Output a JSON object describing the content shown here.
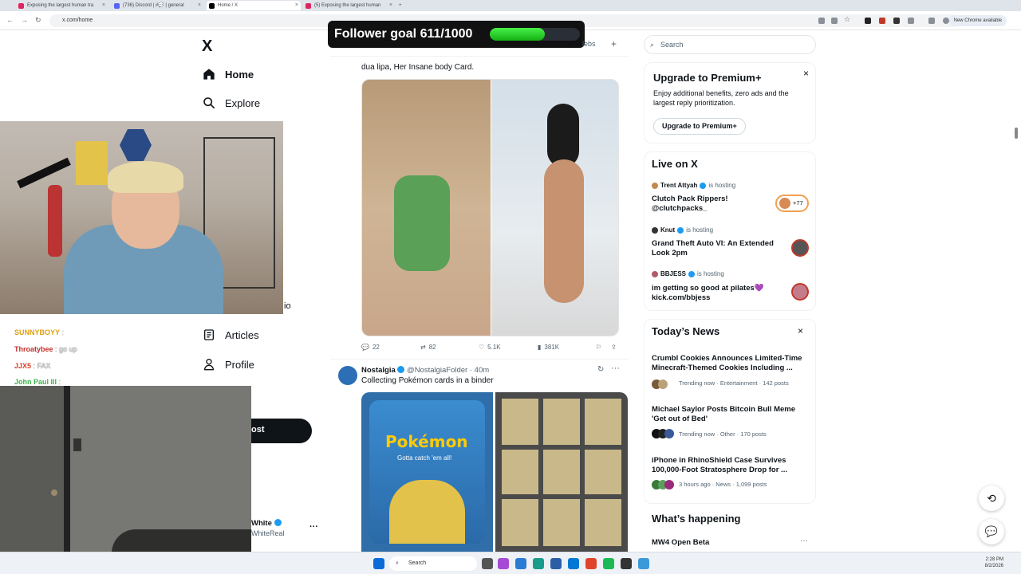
{
  "browser": {
    "tabs": [
      {
        "label": "Exposing the largest human tra",
        "color": "#e0245e"
      },
      {
        "label": "(736) Discord | #💬 | general",
        "color": "#5865f2"
      },
      {
        "label": "Home / X",
        "color": "#000000"
      },
      {
        "label": "(5) Exposing the largest human",
        "color": "#e0245e"
      }
    ],
    "url": "x.com/home",
    "update_label": "New Chrome available"
  },
  "goal": {
    "text": "Follower goal 611/1000",
    "progress": 0.611
  },
  "left_nav": {
    "logo": "X",
    "items": [
      {
        "label": "Home",
        "icon": "home-icon"
      },
      {
        "label": "Explore",
        "icon": "search-icon"
      },
      {
        "label": "Articles",
        "icon": "articles-icon"
      },
      {
        "label": "Profile",
        "icon": "profile-icon"
      }
    ],
    "post_partial": "ost",
    "account_name_partial": "White",
    "account_handle_partial": "WhiteReal",
    "partial_io": "io"
  },
  "chat": [
    {
      "user": "SUNNYBOYY",
      "msg": ":",
      "color": "#e0a010"
    },
    {
      "user": "Throatybee",
      "msg": ": go up",
      "color": "#c0302b"
    },
    {
      "user": "JJX5",
      "msg": ": FAX",
      "color": "#d8402a"
    },
    {
      "user": "John Paul III",
      "msg": ":",
      "color": "#3cb44b"
    }
  ],
  "feed": {
    "tab_partial": "lebs",
    "tweet1": {
      "text": "dua lipa, Her Insane body Card.",
      "replies": "22",
      "reposts": "82",
      "likes": "5.1K",
      "views": "381K"
    },
    "tweet2": {
      "name": "Nostalgia",
      "handle": "@NostalgiaFolder",
      "time": "· 40m",
      "text": "Collecting Pokémon cards in a binder",
      "image_text": "Pokémon",
      "image_sub": "Gotta catch 'em all!"
    }
  },
  "sidebar": {
    "search_placeholder": "Search",
    "premium": {
      "title": "Upgrade to Premium+",
      "desc": "Enjoy additional benefits, zero ads and the largest reply prioritization.",
      "button": "Upgrade to Premium+"
    },
    "live": {
      "title": "Live on X",
      "items": [
        {
          "host": "Trent Attyah",
          "hosting": "is hosting",
          "title": "Clutch Pack Rippers! @clutchpacks_",
          "badge": "+77"
        },
        {
          "host": "Knut",
          "hosting": "is hosting",
          "title": "Grand Theft Auto VI: An Extended Look 2pm"
        },
        {
          "host": "BBJESS",
          "hosting": "is hosting",
          "title": "im getting so good at pilates💜 kick.com/bbjess"
        }
      ]
    },
    "news": {
      "title": "Today’s News",
      "items": [
        {
          "title": "Crumbl Cookies Announces Limited-Time Minecraft-Themed Cookies Including ...",
          "meta": "Trending now · Entertainment · 142 posts"
        },
        {
          "title": "Michael Saylor Posts Bitcoin Bull Meme 'Get out of Bed'",
          "meta": "Trending now · Other · 170 posts"
        },
        {
          "title": "iPhone in RhinoShield Case Survives 100,000-Foot Stratosphere Drop for ...",
          "meta": "3 hours ago · News · 1,099 posts"
        }
      ]
    },
    "whats_happening": {
      "title": "What’s happening",
      "first": "MW4 Open Beta"
    }
  },
  "taskbar": {
    "search": "Search",
    "time": "2:28 PM",
    "date": "8/2/2026"
  }
}
